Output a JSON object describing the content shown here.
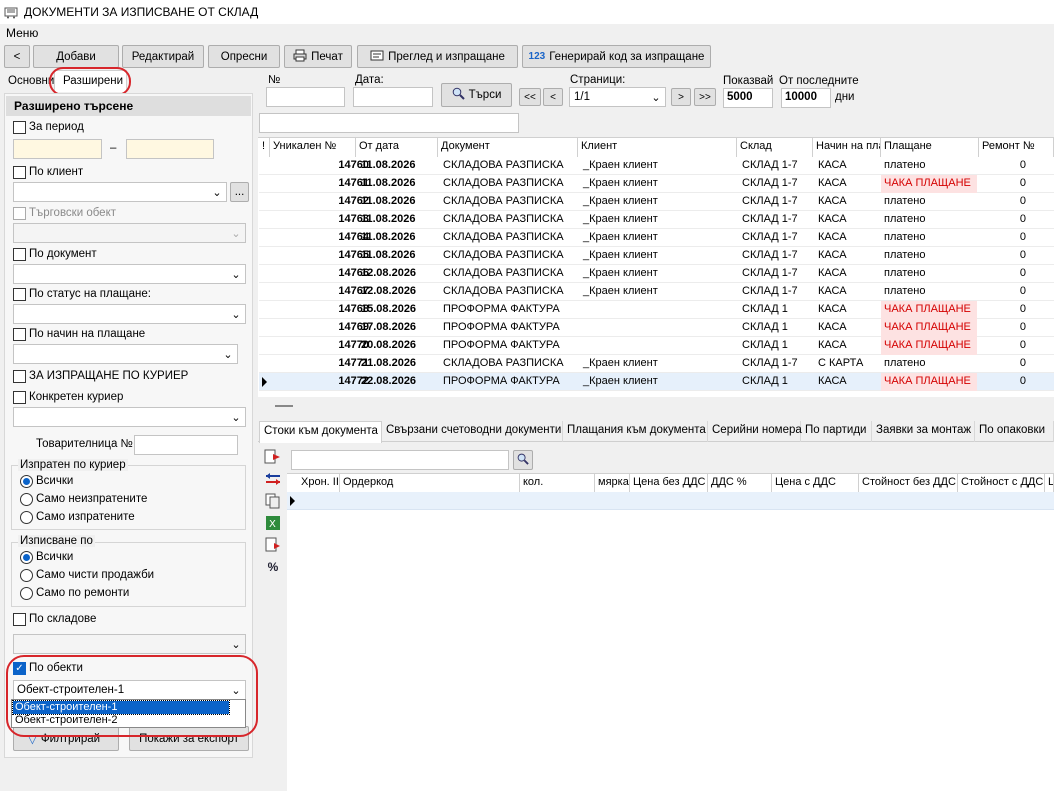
{
  "window": {
    "title": "ДОКУМЕНТИ ЗА ИЗПИСВАНЕ ОТ СКЛАД"
  },
  "menu": {
    "label": "Меню"
  },
  "toolbar": {
    "back": "<",
    "add": "Добави",
    "edit": "Редактирай",
    "refresh": "Опресни",
    "print": "Печат",
    "preview": "Преглед и изпращане",
    "gen_code": "Генерирай код за изпращане",
    "gen_icon": "123"
  },
  "left_tabs": {
    "basic": "Основни",
    "advanced": "Разширени"
  },
  "search": {
    "title": "Разширено търсене",
    "period": "За период",
    "dash": "–",
    "client": "По клиент",
    "ellipsis": "...",
    "trade_object": "Търговски обект",
    "document": "По документ",
    "pay_status": "По статус на плащане:",
    "pay_method": "По начин на плащане",
    "courier_send": "ЗА ИЗПРАЩАНЕ ПО КУРИЕР",
    "courier": "Конкретен куриер",
    "waybill": "Товарителница №",
    "sent_group": {
      "title": "Изпратен по куриер",
      "opts": [
        "Всички",
        "Само неизпратените",
        "Само изпратените"
      ]
    },
    "issue_group": {
      "title": "Изписване по",
      "opts": [
        "Всички",
        "Само чисти продажби",
        "Само по ремонти"
      ]
    },
    "warehouses": "По складове",
    "objects": "По обекти",
    "objects_selected": "Обект-строителен-1",
    "objects_list": [
      "Обект-строителен-1",
      "Обект-строителен-2"
    ],
    "filter_btn": "Филтрирай",
    "export_btn": "Покажи за експорт"
  },
  "top_filter": {
    "no": "№",
    "date": "Дата:",
    "search_btn": "Търси",
    "first": "<<",
    "prev": "<",
    "pages_label": "Страници:",
    "pages_value": "1/1",
    "next": ">",
    "last": ">>",
    "show_label": "Показвай",
    "show_value": "5000",
    "since_label": "От последните",
    "since_value": "10000",
    "days": "дни"
  },
  "grid": {
    "headers": [
      "!",
      "Уникален №",
      "От дата",
      "Документ",
      "Клиент",
      "Склад",
      "Начин на пла",
      "Плащане",
      "Ремонт №"
    ],
    "rows": [
      {
        "id": "14760",
        "date": "11.08.2026",
        "doc": "СКЛАДОВА РАЗПИСКА",
        "client": "_Краен клиент",
        "wh": "СКЛАД 1-7",
        "method": "КАСА",
        "pay": "платено",
        "rep": "0",
        "unpaid": false
      },
      {
        "id": "14761",
        "date": "11.08.2026",
        "doc": "СКЛАДОВА РАЗПИСКА",
        "client": "_Краен клиент",
        "wh": "СКЛАД 1-7",
        "method": "КАСА",
        "pay": "ЧАКА ПЛАЩАНЕ",
        "rep": "0",
        "unpaid": true
      },
      {
        "id": "14762",
        "date": "11.08.2026",
        "doc": "СКЛАДОВА РАЗПИСКА",
        "client": "_Краен клиент",
        "wh": "СКЛАД 1-7",
        "method": "КАСА",
        "pay": "платено",
        "rep": "0",
        "unpaid": false
      },
      {
        "id": "14763",
        "date": "11.08.2026",
        "doc": "СКЛАДОВА РАЗПИСКА",
        "client": "_Краен клиент",
        "wh": "СКЛАД 1-7",
        "method": "КАСА",
        "pay": "платено",
        "rep": "0",
        "unpaid": false
      },
      {
        "id": "14764",
        "date": "11.08.2026",
        "doc": "СКЛАДОВА РАЗПИСКА",
        "client": "_Краен клиент",
        "wh": "СКЛАД 1-7",
        "method": "КАСА",
        "pay": "платено",
        "rep": "0",
        "unpaid": false
      },
      {
        "id": "14765",
        "date": "11.08.2026",
        "doc": "СКЛАДОВА РАЗПИСКА",
        "client": "_Краен клиент",
        "wh": "СКЛАД 1-7",
        "method": "КАСА",
        "pay": "платено",
        "rep": "0",
        "unpaid": false
      },
      {
        "id": "14766",
        "date": "12.08.2026",
        "doc": "СКЛАДОВА РАЗПИСКА",
        "client": "_Краен клиент",
        "wh": "СКЛАД 1-7",
        "method": "КАСА",
        "pay": "платено",
        "rep": "0",
        "unpaid": false
      },
      {
        "id": "14767",
        "date": "12.08.2026",
        "doc": "СКЛАДОВА РАЗПИСКА",
        "client": "_Краен клиент",
        "wh": "СКЛАД 1-7",
        "method": "КАСА",
        "pay": "платено",
        "rep": "0",
        "unpaid": false
      },
      {
        "id": "14768",
        "date": "15.08.2026",
        "doc": "ПРОФОРМА ФАКТУРА",
        "client": "",
        "wh": "СКЛАД 1",
        "method": "КАСА",
        "pay": "ЧАКА ПЛАЩАНЕ",
        "rep": "0",
        "unpaid": true
      },
      {
        "id": "14769",
        "date": "17.08.2026",
        "doc": "ПРОФОРМА ФАКТУРА",
        "client": "",
        "wh": "СКЛАД 1",
        "method": "КАСА",
        "pay": "ЧАКА ПЛАЩАНЕ",
        "rep": "0",
        "unpaid": true
      },
      {
        "id": "14770",
        "date": "20.08.2026",
        "doc": "ПРОФОРМА ФАКТУРА",
        "client": "",
        "wh": "СКЛАД 1",
        "method": "КАСА",
        "pay": "ЧАКА ПЛАЩАНЕ",
        "rep": "0",
        "unpaid": true
      },
      {
        "id": "14771",
        "date": "21.08.2026",
        "doc": "СКЛАДОВА РАЗПИСКА",
        "client": "_Краен клиент",
        "wh": "СКЛАД 1-7",
        "method": "С КАРТА",
        "pay": "платено",
        "rep": "0",
        "unpaid": false
      },
      {
        "id": "14772",
        "date": "22.08.2026",
        "doc": "ПРОФОРМА ФАКТУРА",
        "client": "_Краен клиент",
        "wh": "СКЛАД 1",
        "method": "КАСА",
        "pay": "ЧАКА ПЛАЩАНЕ",
        "rep": "0",
        "unpaid": true
      }
    ]
  },
  "detail_tabs": [
    "Стоки към документа",
    "Свързани счетоводни документи",
    "Плащания към документа",
    "Серийни номера",
    "По партиди",
    "Заявки за монтаж",
    "По опаковки"
  ],
  "detail_grid": {
    "headers": [
      "Хрон. II",
      "Ордеркод",
      "кол.",
      "мярка",
      "Цена без ДДС",
      "ДДС %",
      "Цена с ДДС",
      "Стойност без ДДС",
      "Стойност с ДДС",
      "Ц"
    ]
  },
  "detail_tools": {
    "percent": "%"
  },
  "colors": {
    "accent": "#0b63c9",
    "unpaid_bg": "#fde2e2",
    "unpaid_fg": "#d40000",
    "highlight_ring": "#d7262b",
    "period_input": "#fff8e1"
  }
}
